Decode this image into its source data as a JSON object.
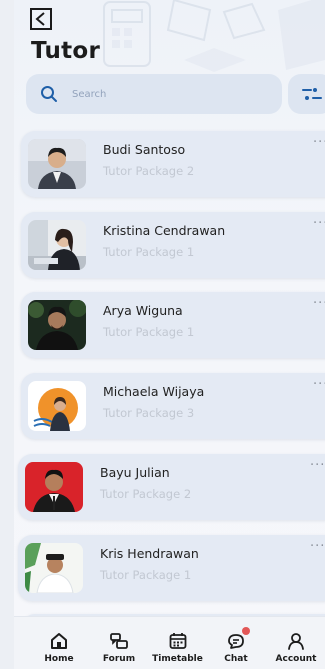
{
  "header": {
    "title": "Tutor"
  },
  "search": {
    "placeholder": "Search"
  },
  "tutors": [
    {
      "name": "Budi Santoso",
      "package": "Tutor Package 2"
    },
    {
      "name": "Kristina Cendrawan",
      "package": "Tutor Package 1"
    },
    {
      "name": "Arya Wiguna",
      "package": "Tutor Package 1"
    },
    {
      "name": "Michaela Wijaya",
      "package": "Tutor Package 3"
    },
    {
      "name": "Bayu Julian",
      "package": "Tutor Package 2"
    },
    {
      "name": "Kris Hendrawan",
      "package": "Tutor Package 1"
    }
  ],
  "more_label": "···",
  "bottom_nav": [
    {
      "label": "Home",
      "icon": "home-icon"
    },
    {
      "label": "Forum",
      "icon": "forum-icon"
    },
    {
      "label": "Timetable",
      "icon": "calendar-icon"
    },
    {
      "label": "Chat",
      "icon": "chat-icon",
      "badge": ""
    },
    {
      "label": "Account",
      "icon": "person-icon"
    }
  ],
  "colors": {
    "accent": "#1f5fa8",
    "card": "#e4eaf4",
    "subtext": "#c2c8d2"
  }
}
